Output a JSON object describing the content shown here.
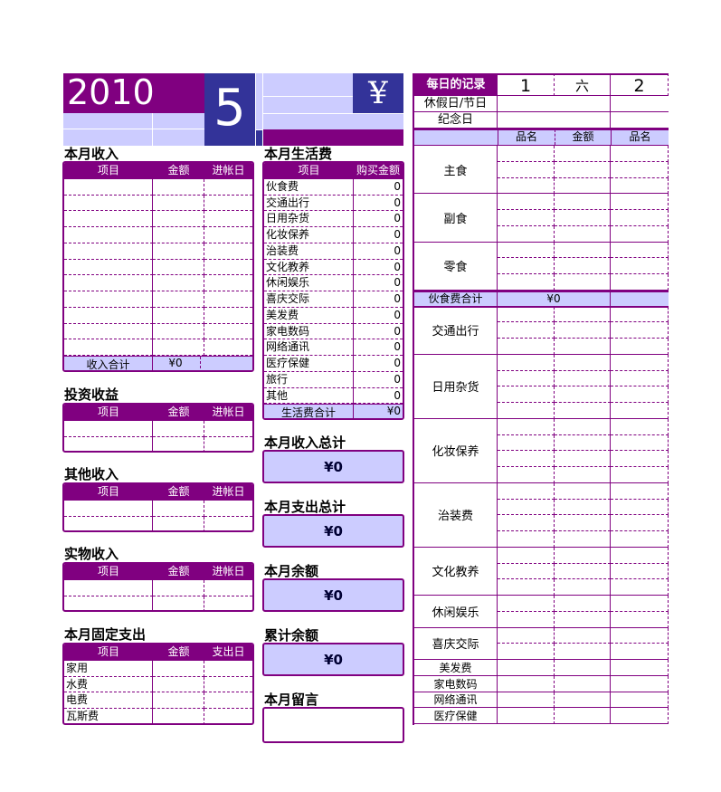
{
  "header": {
    "year": "2010",
    "month": "5",
    "currency_symbol": "¥"
  },
  "colors": {
    "purple": "#800080",
    "blue": "#333399",
    "lavender": "#ccccff"
  },
  "income": {
    "title": "本月收入",
    "columns": [
      "项目",
      "金额",
      "进帐日"
    ],
    "rows": 11,
    "total_label": "收入合计",
    "total_value": "¥0"
  },
  "investment": {
    "title": "投资收益",
    "columns": [
      "项目",
      "金额",
      "进帐日"
    ],
    "rows": 2
  },
  "other_income": {
    "title": "其他收入",
    "columns": [
      "项目",
      "金额",
      "进帐日"
    ],
    "rows": 2
  },
  "in_kind_income": {
    "title": "实物收入",
    "columns": [
      "项目",
      "金额",
      "进帐日"
    ],
    "rows": 2
  },
  "fixed_expense": {
    "title": "本月固定支出",
    "columns": [
      "项目",
      "金额",
      "支出日"
    ],
    "items": [
      "家用",
      "水费",
      "电费",
      "瓦斯费"
    ]
  },
  "living_expense": {
    "title": "本月生活费",
    "columns": [
      "项目",
      "购买金额"
    ],
    "items": [
      {
        "name": "伙食费",
        "amount": "0"
      },
      {
        "name": "交通出行",
        "amount": "0"
      },
      {
        "name": "日用杂货",
        "amount": "0"
      },
      {
        "name": "化妆保养",
        "amount": "0"
      },
      {
        "name": "治装费",
        "amount": "0"
      },
      {
        "name": "文化教养",
        "amount": "0"
      },
      {
        "name": "休闲娱乐",
        "amount": "0"
      },
      {
        "name": "喜庆交际",
        "amount": "0"
      },
      {
        "name": "美发费",
        "amount": "0"
      },
      {
        "name": "家电数码",
        "amount": "0"
      },
      {
        "name": "网络通讯",
        "amount": "0"
      },
      {
        "name": "医疗保健",
        "amount": "0"
      },
      {
        "name": "旅行",
        "amount": "0"
      },
      {
        "name": "其他",
        "amount": "0"
      }
    ],
    "total_label": "生活费合计",
    "total_value": "¥0"
  },
  "summaries": [
    {
      "title": "本月收入总计",
      "value": "¥0"
    },
    {
      "title": "本月支出总计",
      "value": "¥0"
    },
    {
      "title": "本月余额",
      "value": "¥0"
    },
    {
      "title": "累计余额",
      "value": "¥0"
    }
  ],
  "memo": {
    "title": "本月留言"
  },
  "daily": {
    "title": "每日的记录",
    "days": [
      {
        "day": "1",
        "weekday": "六"
      },
      {
        "day": "2"
      }
    ],
    "holiday_label": "休假日/节日",
    "anniversary_label": "纪念日",
    "columns": [
      "品名",
      "金额",
      "品名"
    ],
    "categories": [
      {
        "name": "主食",
        "rows": 3
      },
      {
        "name": "副食",
        "rows": 3
      },
      {
        "name": "零食",
        "rows": 3
      },
      {
        "name": "伙食费合计",
        "total": true,
        "value": "¥0"
      },
      {
        "name": "交通出行",
        "rows": 3
      },
      {
        "name": "日用杂货",
        "rows": 4
      },
      {
        "name": "化妆保养",
        "rows": 4
      },
      {
        "name": "治装费",
        "rows": 4
      },
      {
        "name": "文化教养",
        "rows": 3
      },
      {
        "name": "休闲娱乐",
        "rows": 2
      },
      {
        "name": "喜庆交际",
        "rows": 2
      },
      {
        "name": "美发费",
        "rows": 1
      },
      {
        "name": "家电数码",
        "rows": 1
      },
      {
        "name": "网络通讯",
        "rows": 1
      },
      {
        "name": "医疗保健",
        "rows": 1
      }
    ]
  }
}
